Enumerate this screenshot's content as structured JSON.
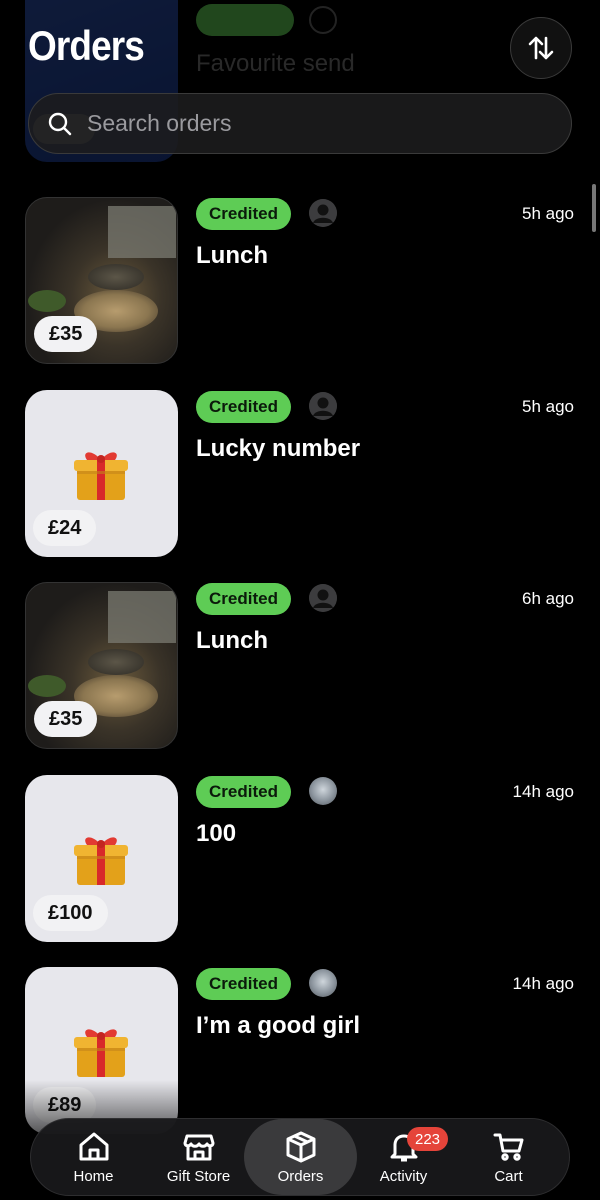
{
  "header": {
    "title": "Orders",
    "sort_icon": "sort-arrows-icon"
  },
  "ghost_row": {
    "title": "Favourite send",
    "badge": "Credited"
  },
  "search": {
    "placeholder": "Search orders",
    "icon": "search-icon"
  },
  "orders": [
    {
      "status": "Credited",
      "title": "Lunch",
      "time": "5h ago",
      "price": "£35",
      "thumb": "food-photo",
      "avatar": "default"
    },
    {
      "status": "Credited",
      "title": "Lucky number",
      "time": "5h ago",
      "price": "£24",
      "thumb": "gift-icon",
      "avatar": "default"
    },
    {
      "status": "Credited",
      "title": "Lunch",
      "time": "6h ago",
      "price": "£35",
      "thumb": "food-photo",
      "avatar": "default"
    },
    {
      "status": "Credited",
      "title": "100",
      "time": "14h ago",
      "price": "£100",
      "thumb": "gift-icon",
      "avatar": "photo"
    },
    {
      "status": "Credited",
      "title": "I’m a good girl",
      "time": "14h ago",
      "price": "£89",
      "thumb": "gift-icon",
      "avatar": "photo"
    }
  ],
  "tab_bar": {
    "items": [
      {
        "label": "Home",
        "icon": "home-icon"
      },
      {
        "label": "Gift Store",
        "icon": "store-icon"
      },
      {
        "label": "Orders",
        "icon": "box-icon",
        "active": true
      },
      {
        "label": "Activity",
        "icon": "bell-icon",
        "badge": "223"
      },
      {
        "label": "Cart",
        "icon": "cart-icon"
      }
    ]
  },
  "colors": {
    "background": "#000000",
    "credited_green": "#5ecc55",
    "badge_red": "#e5443a",
    "surface": "#1c1c1e"
  }
}
